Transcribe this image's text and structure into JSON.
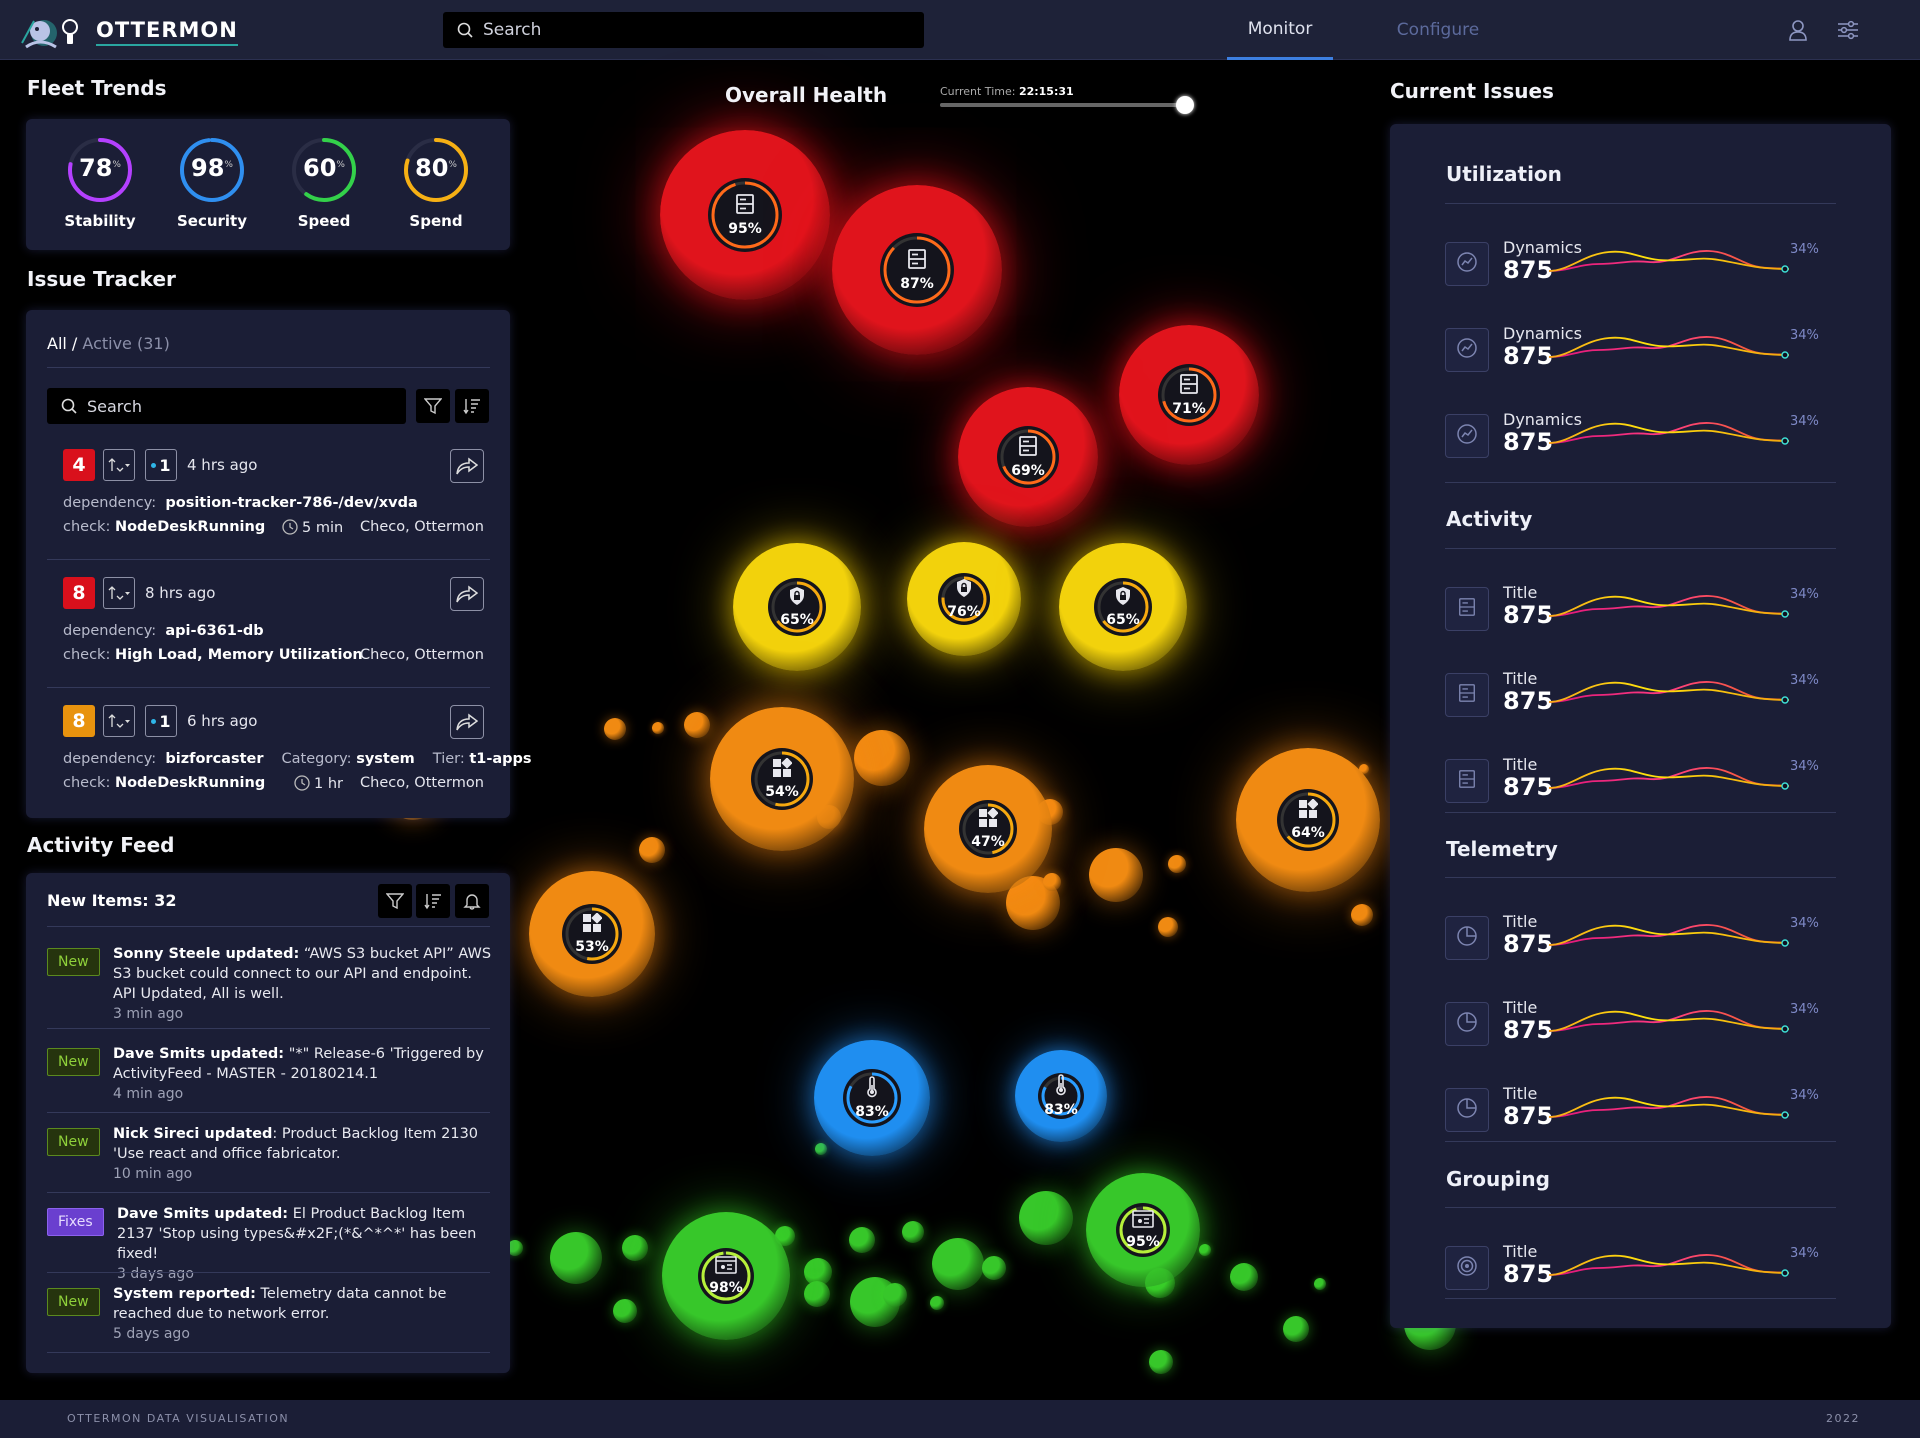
{
  "app": {
    "name": "OTTERMON"
  },
  "header": {
    "search_placeholder": "Search",
    "nav": [
      {
        "label": "Monitor",
        "active": true
      },
      {
        "label": "Configure",
        "active": false
      }
    ],
    "icons": [
      "user-icon",
      "sliders-icon"
    ]
  },
  "fleet_trends": {
    "title": "Fleet Trends",
    "gauges": [
      {
        "label": "Stability",
        "value": "78",
        "unit": "%",
        "percent": 78,
        "color": "#b440ff"
      },
      {
        "label": "Security",
        "value": "98",
        "unit": "%",
        "percent": 98,
        "color": "#2f8ff0"
      },
      {
        "label": "Speed",
        "value": "60",
        "unit": "%",
        "percent": 60,
        "color": "#33d14a"
      },
      {
        "label": "Spend",
        "value": "80",
        "unit": "%",
        "percent": 80,
        "color": "#f6b014"
      }
    ]
  },
  "issue_tracker": {
    "title": "Issue Tracker",
    "filter_all": "All",
    "filter_sep": " / ",
    "filter_active": "Active (31)",
    "search_placeholder": "Search",
    "issues": [
      {
        "severity": "4",
        "severity_color": "#d9101c",
        "count": "1",
        "ago": "4 hrs ago",
        "dependency_label": "dependency:",
        "dependency": "position-tracker-786-/dev/xvda",
        "check_label": "check:",
        "check": "NodeDeskRunning",
        "duration": "5 min",
        "owners": "Checo, Ottermon"
      },
      {
        "severity": "8",
        "severity_color": "#d9101c",
        "ago": "8 hrs ago",
        "dependency_label": "dependency:",
        "dependency": "api-6361-db",
        "check_label": "check:",
        "check": "High Load, Memory Utilization",
        "owners": "Checo, Ottermon"
      },
      {
        "severity": "8",
        "severity_color": "#e8930e",
        "count": "1",
        "ago": "6 hrs ago",
        "dependency_label": "dependency:",
        "dependency": "bizforcaster",
        "category_label": "Category:",
        "category": "system",
        "tier_label": "Tier:",
        "tier": "t1-apps",
        "check_label": "check:",
        "check": "NodeDeskRunning",
        "duration": "1 hr",
        "owners": "Checo, Ottermon"
      }
    ]
  },
  "activity_feed": {
    "title": "Activity Feed",
    "new_items": "New Items: 32",
    "items": [
      {
        "tag": "New",
        "author": "Sonny Steele updated:",
        "text": " “AWS S3 bucket API” AWS S3 bucket could connect to our API and endpoint. API Updated, All is well.",
        "time": "3 min ago"
      },
      {
        "tag": "New",
        "author": "Dave Smits updated:",
        "text": " \"*\" Release-6 'Triggered by ActivityFeed - MASTER - 20180214.1",
        "time": "4 min ago"
      },
      {
        "tag": "New",
        "author": "Nick Sireci updated",
        "text": ": Product Backlog Item 2130 'Use react and office fabricator.",
        "time": "10 min ago"
      },
      {
        "tag": "Fixes",
        "author": "Dave Smits updated:",
        "text": " El Product Backlog Item 2137 'Stop using types&#x2F;(*&^*^*' has been fixed!",
        "time": "3 days ago"
      },
      {
        "tag": "New",
        "author": "System reported:",
        "text": " Telemetry data cannot be reached due to network error.",
        "time": "5 days ago"
      }
    ]
  },
  "overall_health": {
    "title": "Overall Health",
    "time_label": "Current Time:",
    "time_value": "22:15:31",
    "slider_position": 0.98,
    "nodes": [
      {
        "pct": "95%",
        "percent": 95,
        "icon": "server-icon",
        "color": "red"
      },
      {
        "pct": "87%",
        "percent": 87,
        "icon": "server-icon",
        "color": "red"
      },
      {
        "pct": "71%",
        "percent": 71,
        "icon": "server-icon",
        "color": "red"
      },
      {
        "pct": "69%",
        "percent": 69,
        "icon": "server-icon",
        "color": "red"
      },
      {
        "pct": "65%",
        "percent": 65,
        "icon": "shield-icon",
        "color": "yellow"
      },
      {
        "pct": "76%",
        "percent": 76,
        "icon": "shield-icon",
        "color": "yellow"
      },
      {
        "pct": "65%",
        "percent": 65,
        "icon": "shield-icon",
        "color": "yellow"
      },
      {
        "pct": "54%",
        "percent": 54,
        "icon": "apps-icon",
        "color": "orange"
      },
      {
        "pct": "47%",
        "percent": 47,
        "icon": "apps-icon",
        "color": "orange"
      },
      {
        "pct": "64%",
        "percent": 64,
        "icon": "apps-icon",
        "color": "orange"
      },
      {
        "pct": "53%",
        "percent": 53,
        "icon": "apps-icon",
        "color": "orange"
      },
      {
        "pct": "83%",
        "percent": 83,
        "icon": "thermometer-icon",
        "color": "blue"
      },
      {
        "pct": "83%",
        "percent": 83,
        "icon": "thermometer-icon",
        "color": "blue"
      },
      {
        "pct": "95%",
        "percent": 95,
        "icon": "browser-icon",
        "color": "green"
      },
      {
        "pct": "98%",
        "percent": 98,
        "icon": "browser-icon",
        "color": "green"
      }
    ]
  },
  "current_issues": {
    "title": "Current Issues",
    "groups": [
      {
        "title": "Utilization",
        "icon": "trend-icon",
        "rows": [
          {
            "title": "Dynamics",
            "value": "875",
            "pct": "34%"
          },
          {
            "title": "Dynamics",
            "value": "875",
            "pct": "34%"
          },
          {
            "title": "Dynamics",
            "value": "875",
            "pct": "34%"
          }
        ]
      },
      {
        "title": "Activity",
        "icon": "server-icon",
        "rows": [
          {
            "title": "Title",
            "value": "875",
            "pct": "34%"
          },
          {
            "title": "Title",
            "value": "875",
            "pct": "34%"
          },
          {
            "title": "Title",
            "value": "875",
            "pct": "34%"
          }
        ]
      },
      {
        "title": "Telemetry",
        "icon": "pie-icon",
        "rows": [
          {
            "title": "Title",
            "value": "875",
            "pct": "34%"
          },
          {
            "title": "Title",
            "value": "875",
            "pct": "34%"
          },
          {
            "title": "Title",
            "value": "875",
            "pct": "34%"
          }
        ]
      },
      {
        "title": "Grouping",
        "icon": "target-icon",
        "rows": [
          {
            "title": "Title",
            "value": "875",
            "pct": "34%"
          }
        ]
      }
    ]
  },
  "footer": {
    "left": "OTTERMON DATA VISUALISATION",
    "right": "2022"
  }
}
